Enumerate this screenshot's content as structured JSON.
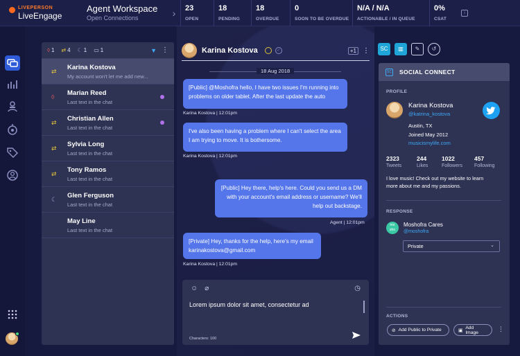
{
  "brand": {
    "line1": "LIVEPERSON",
    "line2": "LiveEngage"
  },
  "workspace": {
    "title": "Agent Workspace",
    "subtitle": "Open Connections"
  },
  "stats": [
    {
      "value": "23",
      "label": "OPEN"
    },
    {
      "value": "18",
      "label": "PENDING"
    },
    {
      "value": "18",
      "label": "OVERDUE"
    },
    {
      "value": "0",
      "label": "SOON TO BE OVERDUE"
    },
    {
      "value": "N/A / N/A",
      "label": "ACTIONABLE / IN QUEUE"
    },
    {
      "value": "0%",
      "label": "CSAT"
    }
  ],
  "list_header": {
    "count_a": "1",
    "count_b": "4",
    "count_c": "1",
    "count_d": "1"
  },
  "conversations": [
    {
      "name": "Karina Kostova",
      "preview": "My account won't let me add new...",
      "icon": "transfer-icon",
      "unread": false,
      "selected": true
    },
    {
      "name": "Marian Reed",
      "preview": "Last text in the chat",
      "icon": "drop-icon",
      "unread": true,
      "selected": false
    },
    {
      "name": "Christian Allen",
      "preview": "Last text in the chat",
      "icon": "transfer-icon",
      "unread": true,
      "selected": false
    },
    {
      "name": "Sylvia Long",
      "preview": "Last text in the chat",
      "icon": "transfer-icon",
      "unread": false,
      "selected": false
    },
    {
      "name": "Tony Ramos",
      "preview": "Last text in the chat",
      "icon": "transfer-icon",
      "unread": false,
      "selected": false
    },
    {
      "name": "Glen Ferguson",
      "preview": "Last text in the chat",
      "icon": "moon-icon",
      "unread": false,
      "selected": false
    },
    {
      "name": "May Line",
      "preview": "Last text in the chat",
      "icon": "none",
      "unread": false,
      "selected": false
    }
  ],
  "chat": {
    "contact_name": "Karina Kostova",
    "plus_badge": "+1",
    "date": "18 Aug 2018",
    "messages": [
      {
        "from": "customer",
        "text_1": "[Public] @Moshofra hello, I have two issues I'm running into",
        "text_2": "problems on older tablet. After the last update the auto",
        "meta": "Karina Kostova  |  12:01pm"
      },
      {
        "from": "customer",
        "text_1": "I've also been having a problem where I can't select the area",
        "text_2": "I am trying to move. It is bothersome.",
        "meta": "Karina Kostova  |  12:01pm"
      },
      {
        "from": "agent",
        "text_1": "[Public] Hey there, help's here. Could you send us a DM",
        "text_2": "with your account's email address or username? We'll",
        "text_3": "help out backstage.",
        "meta": "Agent  |  12:01pm"
      },
      {
        "from": "customer",
        "text_1": "[Private] Hey, thanks for the help, here's my email",
        "text_2": "karinakostova@gmail.com",
        "meta": "Karina Kostova  |  12:01pm"
      }
    ],
    "composer_text": "Lorem ipsum dolor sit amet, consectetur ad",
    "characters": "Characters: 100"
  },
  "social": {
    "title": "SOCIAL CONNECT",
    "profile_label": "PROFILE",
    "name": "Karina Kostova",
    "handle": "@katrina_kostova",
    "location": "Austin, TX",
    "joined": "Joined May 2012",
    "url": "musicismylife.com",
    "stats": [
      {
        "value": "2323",
        "label": "Tweets"
      },
      {
        "value": "244",
        "label": "Likes"
      },
      {
        "value": "1022",
        "label": "Followers"
      },
      {
        "value": "457",
        "label": "Following"
      }
    ],
    "bio_1": "I love music! Check out my website to learn",
    "bio_2": "more about me and my passions.",
    "response_label": "RESPONSE",
    "responder_badge_1": "mo",
    "responder_badge_2": "sho",
    "responder_name": "Moshofra Cares",
    "responder_handle": "@moshofra",
    "visibility": "Private",
    "actions_label": "ACTIONS",
    "action_1": "Add Public to Private",
    "action_2": "Add Image"
  },
  "colors": {
    "accent": "#5576ea",
    "twitter": "#1da1f2",
    "unread": "#b070e8",
    "brand": "#ff6a1f"
  }
}
